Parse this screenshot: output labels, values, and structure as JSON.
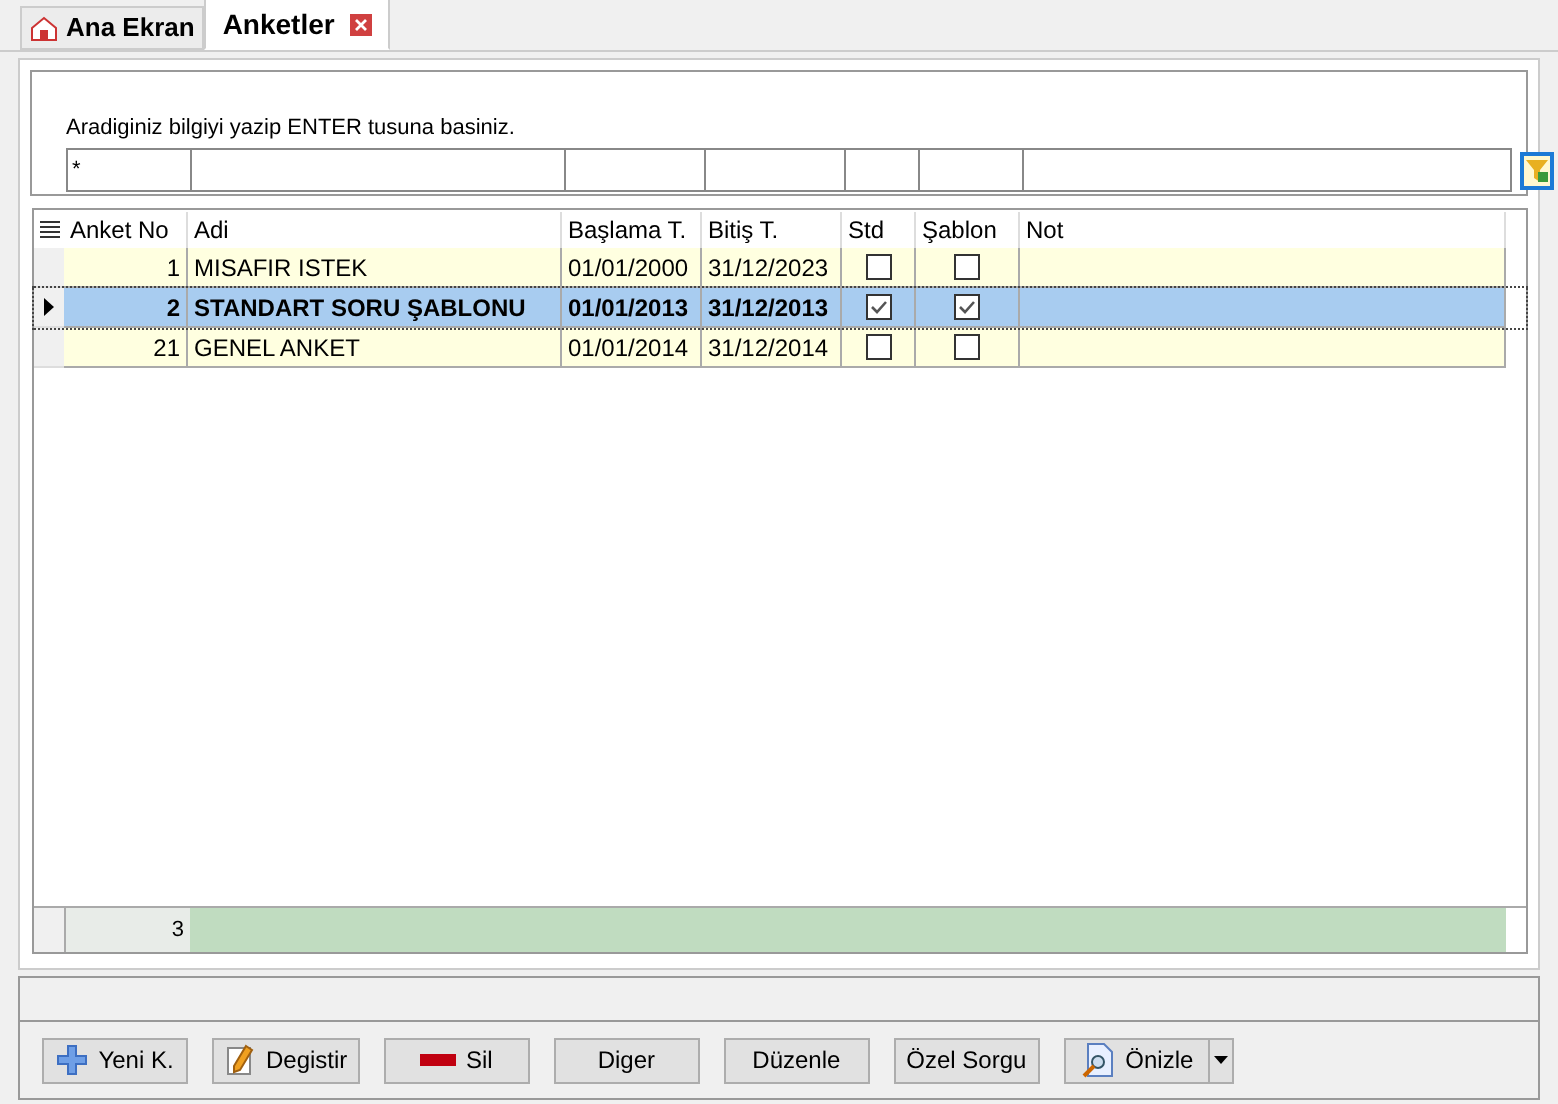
{
  "tabs": [
    {
      "label": "Ana Ekran",
      "selected": false,
      "closable": false
    },
    {
      "label": "Anketler",
      "selected": true,
      "closable": true
    }
  ],
  "search": {
    "hint": "Aradiginiz bilgiyi yazip ENTER tusuna basiniz.",
    "filter_value": "*"
  },
  "table": {
    "columns": [
      "Anket No",
      "Adi",
      "Başlama T.",
      "Bitiş T.",
      "Std",
      "Şablon",
      "Not"
    ],
    "rows": [
      {
        "no": "1",
        "adi": "MISAFIR ISTEK",
        "baslama": "01/01/2000",
        "bitis": "31/12/2023",
        "std": false,
        "sablon": false,
        "selected": false
      },
      {
        "no": "2",
        "adi": "STANDART SORU ŞABLONU",
        "baslama": "01/01/2013",
        "bitis": "31/12/2013",
        "std": true,
        "sablon": true,
        "selected": true
      },
      {
        "no": "21",
        "adi": "GENEL ANKET",
        "baslama": "01/01/2014",
        "bitis": "31/12/2014",
        "std": false,
        "sablon": false,
        "selected": false
      }
    ],
    "footer_count": "3"
  },
  "buttons": [
    {
      "label": "Yeni K.",
      "kind": "plus"
    },
    {
      "label": "Degistir",
      "kind": "pencil"
    },
    {
      "label": "Sil",
      "kind": "minus"
    },
    {
      "label": "Diger",
      "kind": "plain"
    },
    {
      "label": "Düzenle",
      "kind": "plain"
    },
    {
      "label": "Özel Sorgu",
      "kind": "plain"
    },
    {
      "label": "Önizle",
      "kind": "preview",
      "dropdown": true
    }
  ]
}
